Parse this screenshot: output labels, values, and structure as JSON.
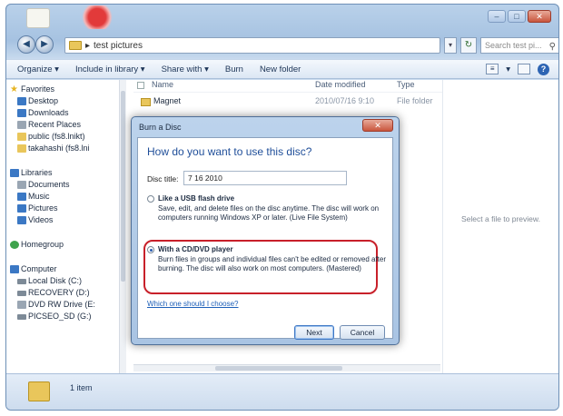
{
  "window": {
    "address": "test pictures",
    "search_placeholder": "Search test pi..."
  },
  "toolbar": {
    "organize": "Organize ▾",
    "include": "Include in library ▾",
    "share": "Share with ▾",
    "burn": "Burn",
    "new_folder": "New folder"
  },
  "sidebar": {
    "favorites": "Favorites",
    "favorites_items": [
      "Desktop",
      "Downloads",
      "Recent Places",
      "public (fs8.lnikt)",
      "takahashi (fs8.lni"
    ],
    "libraries": "Libraries",
    "libraries_items": [
      "Documents",
      "Music",
      "Pictures",
      "Videos"
    ],
    "homegroup": "Homegroup",
    "computer": "Computer",
    "computer_items": [
      "Local Disk (C:)",
      "RECOVERY (D:)",
      "DVD RW Drive (E:",
      "PICSEO_SD (G:)"
    ]
  },
  "file_list": {
    "columns": {
      "name": "Name",
      "date": "Date modified",
      "type": "Type"
    },
    "rows": [
      {
        "name": "Magnet",
        "date": "2010/07/16 9:10",
        "type": "File folder"
      }
    ]
  },
  "preview": {
    "message": "Select a file to preview."
  },
  "details": {
    "count": "1 item"
  },
  "dialog": {
    "title": "Burn a Disc",
    "heading": "How do you want to use this disc?",
    "disc_title_label": "Disc title:",
    "disc_title_value": "7 16 2010",
    "option_usb_label": "Like a USB flash drive",
    "option_usb_desc": "Save, edit, and delete files on the disc anytime. The disc will work on computers running Windows XP or later. (Live File System)",
    "option_cd_label": "With a CD/DVD player",
    "option_cd_desc": "Burn files in groups and individual files can't be edited or removed after burning. The disc will also work on most computers. (Mastered)",
    "help_link": "Which one should I choose?",
    "next_button": "Next",
    "cancel_button": "Cancel",
    "selected_option": "cd"
  },
  "colors": {
    "highlight": "#c8202a",
    "heading": "#1f4e99",
    "link": "#1d5fb8"
  }
}
